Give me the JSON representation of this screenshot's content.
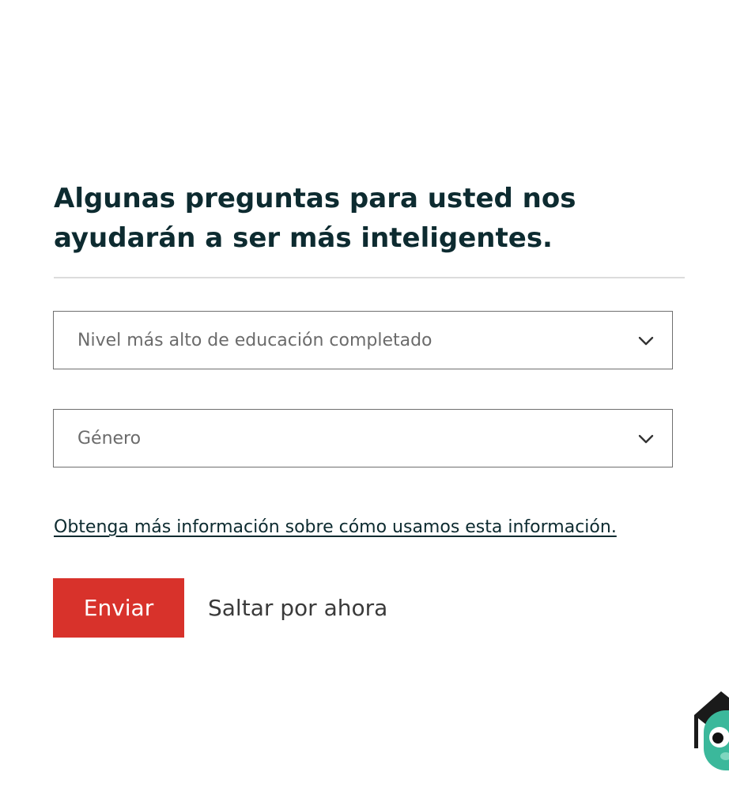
{
  "form": {
    "heading": "Algunas preguntas para usted nos ayudarán a ser más inteligentes.",
    "education_select": {
      "placeholder": "Nivel más alto de educación completado",
      "icon": "chevron-down-icon"
    },
    "gender_select": {
      "placeholder": "Género",
      "icon": "chevron-down-icon"
    },
    "info_link": "Obtenga más información sobre cómo usamos esta información.",
    "submit_label": "Enviar",
    "skip_label": "Saltar por ahora"
  },
  "mascot": {
    "icon": "owl-mascot-icon"
  },
  "colors": {
    "heading_text": "#0d2b30",
    "submit_background": "#d8322b",
    "mascot_body": "#3bb89b"
  }
}
